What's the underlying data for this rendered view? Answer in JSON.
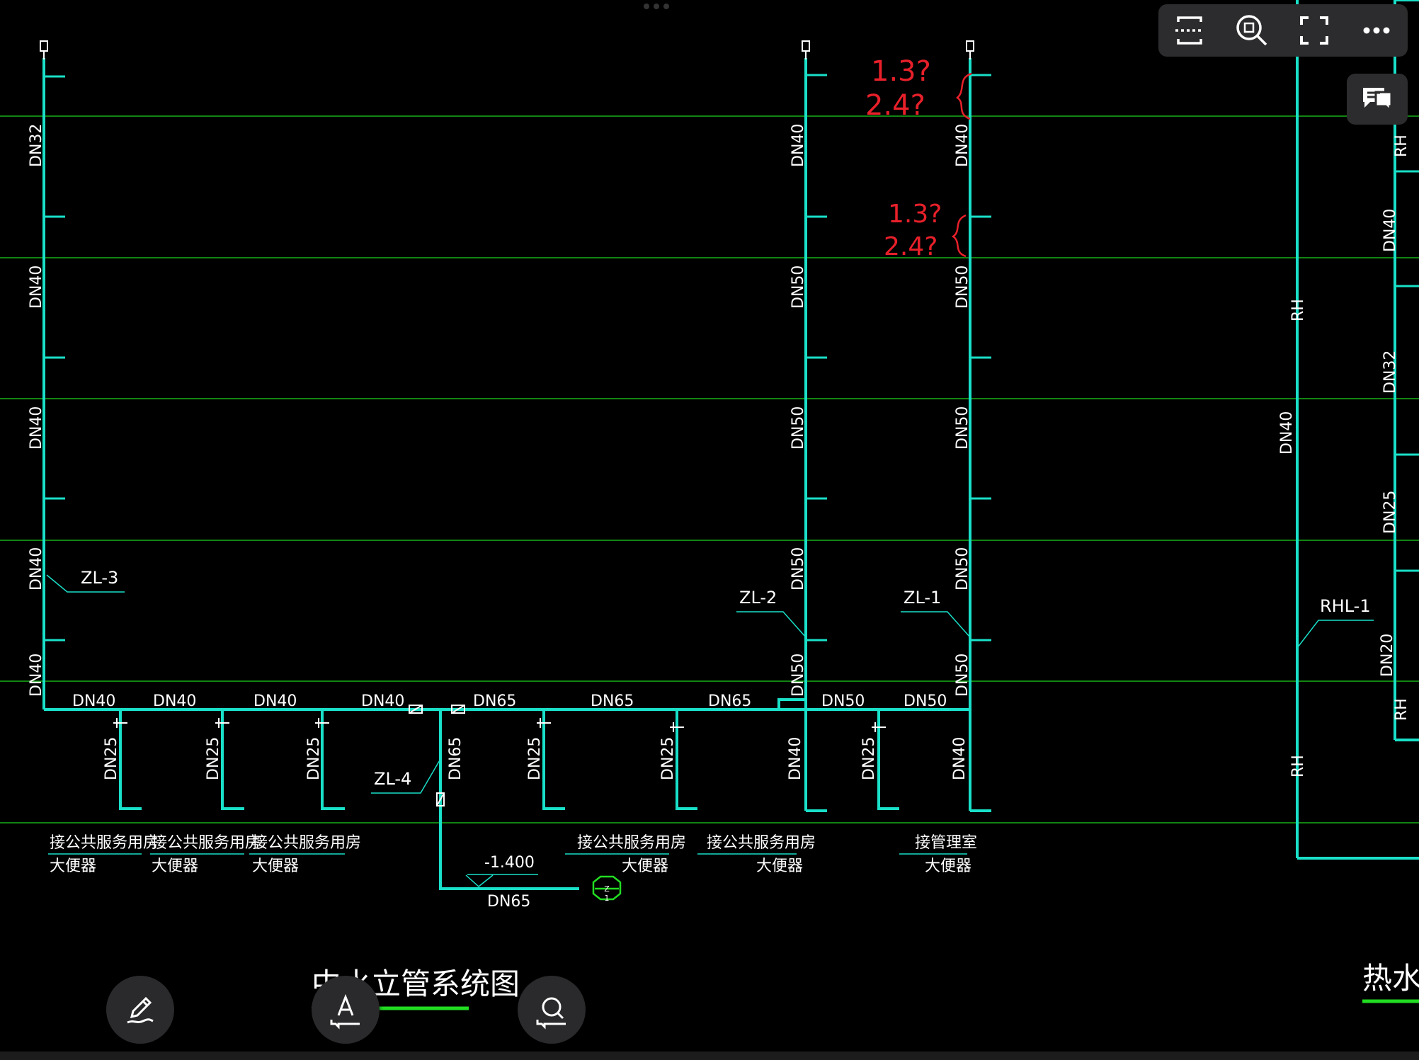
{
  "colors": {
    "background": "#000000",
    "pipe": "#19e0c8",
    "grid": "#18b018",
    "text": "#ffffff",
    "annotation": "#e8202a",
    "toolbar": "#2c2c2e",
    "title_underline": "#22dd22"
  },
  "drawing": {
    "labels": {
      "riser_zl3": "ZL-3",
      "riser_zl2": "ZL-2",
      "riser_zl1": "ZL-1",
      "riser_zl4": "ZL-4",
      "riser_rhl1": "RHL-1",
      "level": "-1.400",
      "outlet_dn": "DN65",
      "marker_top": "Z",
      "marker_bottom": "1"
    },
    "vertical_dn": {
      "zl3": [
        "DN32",
        "DN40",
        "DN40",
        "DN40",
        "DN40"
      ],
      "zl2": [
        "DN40",
        "DN50",
        "DN50",
        "DN50",
        "DN50"
      ],
      "zl1": [
        "DN40",
        "DN50",
        "DN50",
        "DN50",
        "DN50"
      ],
      "rh_riser": [
        "RH",
        "DN40",
        "RH"
      ],
      "right_riser": [
        "RH",
        "DN40",
        "DN32",
        "DN25",
        "DN20",
        "RH"
      ]
    },
    "main_dn": [
      "DN40",
      "DN40",
      "DN40",
      "DN40",
      "DN65",
      "DN65",
      "DN65",
      "DN50",
      "DN50"
    ],
    "branch_dn": [
      "DN25",
      "DN25",
      "DN25",
      "DN65",
      "DN25",
      "DN25",
      "DN40",
      "DN25",
      "DN40"
    ],
    "fixtures": [
      {
        "line1": "接公共服务用房",
        "line2": "大便器"
      },
      {
        "line1": "接公共服务用房",
        "line2": "大便器"
      },
      {
        "line1": "接公共服务用房",
        "line2": "大便器"
      },
      {
        "line1": "接公共服务用房",
        "line2": "大便器"
      },
      {
        "line1": "接公共服务用房",
        "line2": "大便器"
      },
      {
        "line1": "接管理室",
        "line2": "大便器"
      }
    ],
    "title_main": "中水立管系统图",
    "title_right": "热水",
    "annotations": [
      {
        "line1": "1.3?",
        "line2": "2.4?"
      },
      {
        "line1": "1.3?",
        "line2": "2.4?"
      }
    ]
  },
  "toolbar": {
    "icons": [
      "scan-icon",
      "zoom-fit-icon",
      "fullscreen-icon",
      "more-icon"
    ]
  },
  "comment_icon": "comment-icon",
  "fabs": [
    "pen-icon",
    "text-annotation-icon",
    "search-annotation-icon"
  ]
}
